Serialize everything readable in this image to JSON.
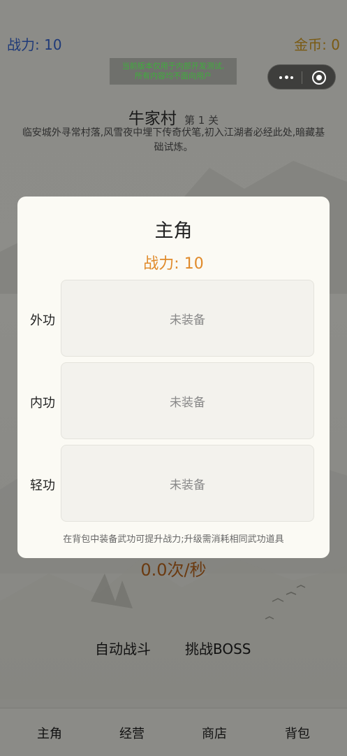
{
  "header": {
    "power_label": "战力: 10",
    "gold_label": "金币: 0",
    "dev_notice_line1": "当前版本仅用于内部开发测试,",
    "dev_notice_line2": "所有内容均不面向用户"
  },
  "capsule": {
    "menu_icon": "more-dots-icon",
    "close_icon": "target-circle-icon"
  },
  "stage": {
    "name": "牛家村",
    "level": "第 1 关",
    "description": "临安城外寻常村落,风雪夜中埋下传奇伏笔,初入江湖者必经此处,暗藏基础试炼。"
  },
  "battle": {
    "rate": "0.0次/秒",
    "auto_battle": "自动战斗",
    "challenge_boss": "挑战BOSS"
  },
  "modal": {
    "title": "主角",
    "power": "战力: 10",
    "slots": [
      {
        "label": "外功",
        "value": "未装备"
      },
      {
        "label": "内功",
        "value": "未装备"
      },
      {
        "label": "轻功",
        "value": "未装备"
      }
    ],
    "hint": "在背包中装备武功可提升战力;升级需消耗相同武功道具"
  },
  "nav": [
    {
      "label": "主角"
    },
    {
      "label": "经营"
    },
    {
      "label": "商店"
    },
    {
      "label": "背包"
    }
  ],
  "colors": {
    "overlay_bg": "#8a8a86",
    "power_blue": "#1f3a78",
    "gold_brown": "#7a5a12",
    "modal_power_orange": "#e08a2a",
    "dev_text_green": "#3fae3c"
  }
}
